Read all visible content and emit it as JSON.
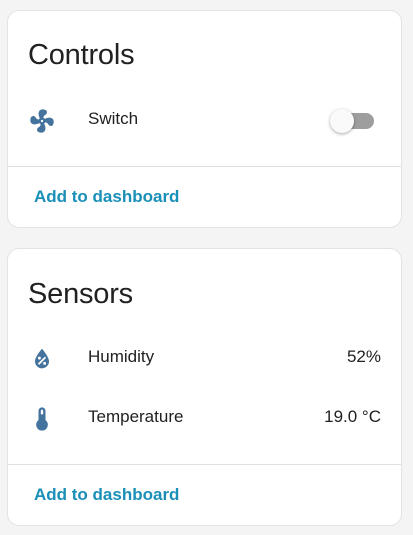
{
  "colors": {
    "icon": "#44739e",
    "accent": "#1a8fb7",
    "toggle_track": "#9e9e9e"
  },
  "controls_card": {
    "title": "Controls",
    "entities": [
      {
        "icon": "fan-icon",
        "label": "Switch",
        "state": "off"
      }
    ],
    "action_label": "Add to dashboard"
  },
  "sensors_card": {
    "title": "Sensors",
    "entities": [
      {
        "icon": "water-percent-icon",
        "label": "Humidity",
        "value": "52%"
      },
      {
        "icon": "thermometer-icon",
        "label": "Temperature",
        "value": "19.0 °C"
      }
    ],
    "action_label": "Add to dashboard"
  }
}
